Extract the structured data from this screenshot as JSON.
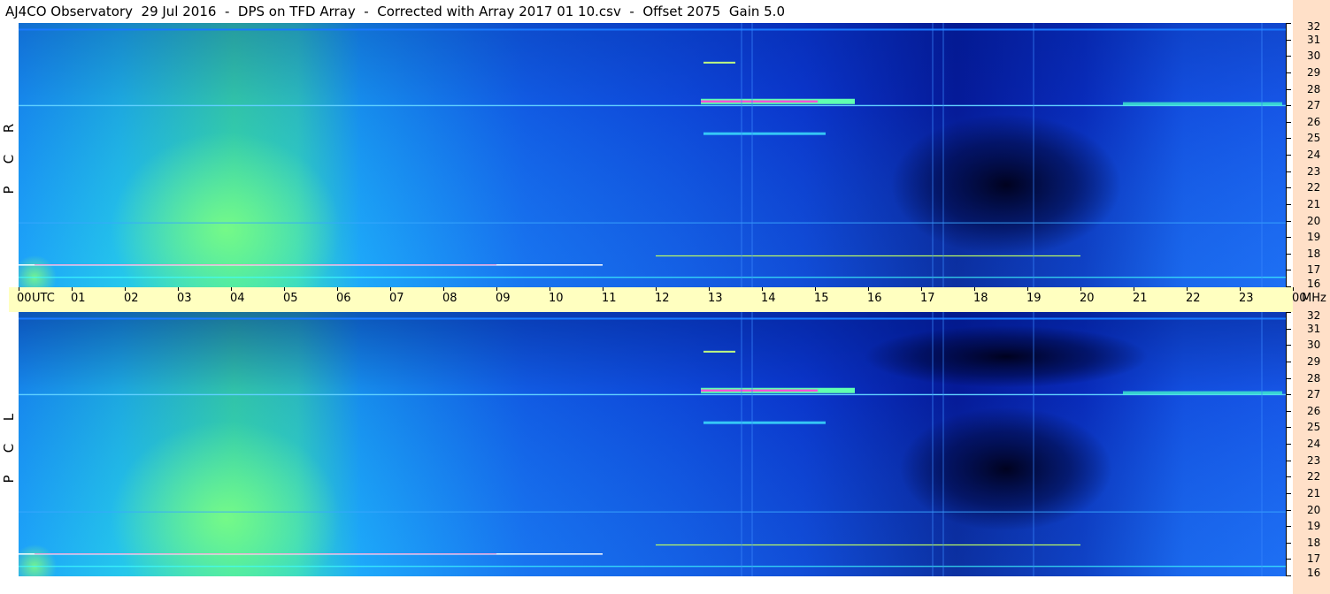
{
  "header": {
    "title": "AJ4CO Observatory  29 Jul 2016  -  DPS on TFD Array  -  Corrected with Array 2017 01 10.csv  -  Offset 2075  Gain 5.0"
  },
  "panels": [
    {
      "label_letters": [
        "R",
        "C",
        "P"
      ]
    },
    {
      "label_letters": [
        "L",
        "C",
        "P"
      ]
    }
  ],
  "time_axis": {
    "labels": [
      "00",
      "UTC",
      "01",
      "02",
      "03",
      "04",
      "05",
      "06",
      "07",
      "08",
      "09",
      "10",
      "11",
      "12",
      "13",
      "14",
      "15",
      "16",
      "17",
      "18",
      "19",
      "20",
      "21",
      "22",
      "23",
      "00"
    ],
    "unit": "MHz"
  },
  "freq_axis": {
    "labels": [
      "32",
      "31",
      "30",
      "29",
      "28",
      "27",
      "26",
      "25",
      "24",
      "23",
      "22",
      "21",
      "20",
      "19",
      "18",
      "17",
      "16"
    ]
  },
  "chart_data": [
    {
      "type": "heatmap",
      "title": "AJ4CO Observatory  29 Jul 2016  -  DPS on TFD Array  -  Corrected with Array 2017 01 10.csv  -  Offset 2075  Gain 5.0",
      "ylabel": "R C P",
      "xlabel": "UTC",
      "x_range_hours_utc": [
        0,
        24
      ],
      "y_range_mhz": [
        16,
        32
      ],
      "x_ticks": [
        "00",
        "01",
        "02",
        "03",
        "04",
        "05",
        "06",
        "07",
        "08",
        "09",
        "10",
        "11",
        "12",
        "13",
        "14",
        "15",
        "16",
        "17",
        "18",
        "19",
        "20",
        "21",
        "22",
        "23",
        "00"
      ],
      "y_ticks_mhz": [
        32,
        31,
        30,
        29,
        28,
        27,
        26,
        25,
        24,
        23,
        22,
        21,
        20,
        19,
        18,
        17,
        16
      ]
    },
    {
      "type": "heatmap",
      "ylabel": "L C P",
      "xlabel": "UTC",
      "x_range_hours_utc": [
        0,
        24
      ],
      "y_range_mhz": [
        16,
        32
      ],
      "x_ticks": [
        "00",
        "01",
        "02",
        "03",
        "04",
        "05",
        "06",
        "07",
        "08",
        "09",
        "10",
        "11",
        "12",
        "13",
        "14",
        "15",
        "16",
        "17",
        "18",
        "19",
        "20",
        "21",
        "22",
        "23",
        "00"
      ],
      "y_ticks_mhz": [
        32,
        31,
        30,
        29,
        28,
        27,
        26,
        25,
        24,
        23,
        22,
        21,
        20,
        19,
        18,
        17,
        16
      ]
    }
  ]
}
